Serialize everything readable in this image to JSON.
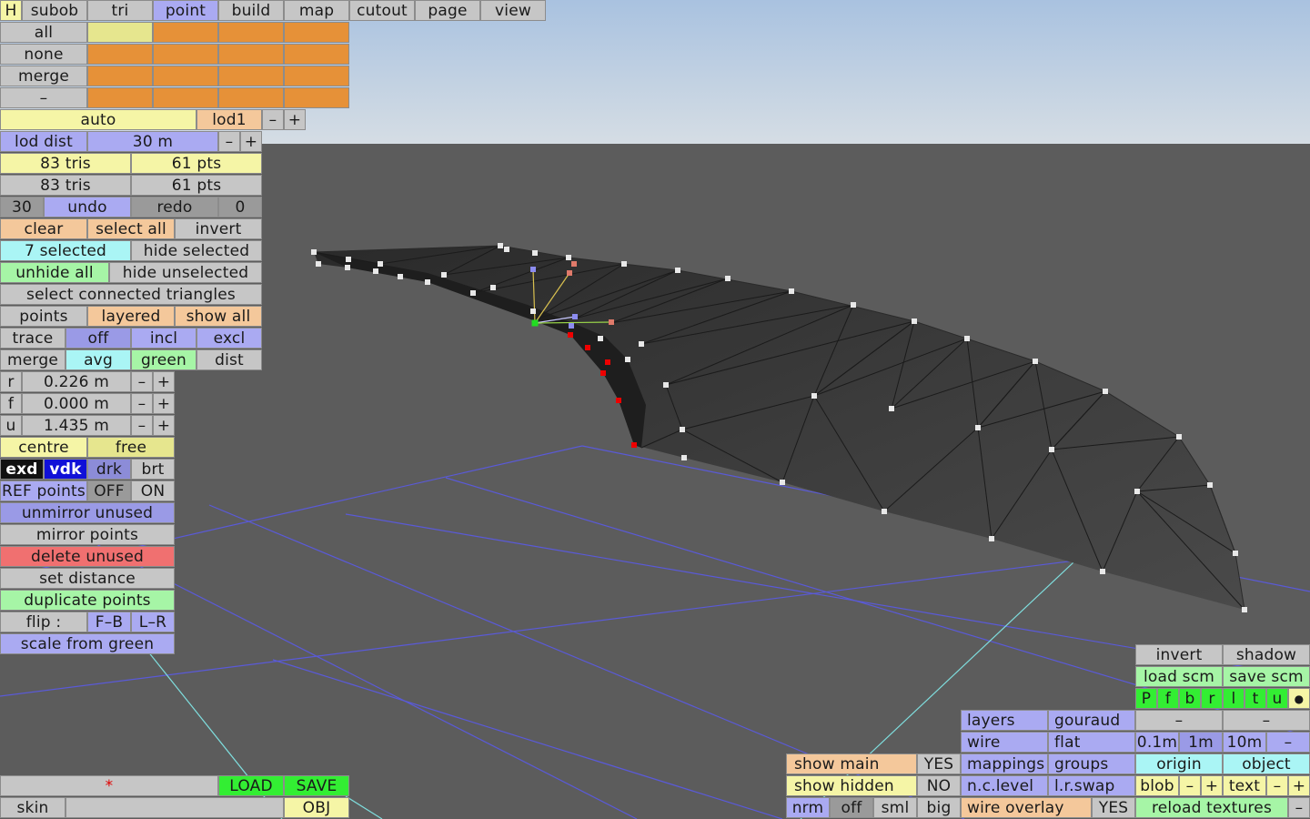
{
  "menu": {
    "h": "H",
    "subob": "subob",
    "tri": "tri",
    "point": "point",
    "build": "build",
    "map": "map",
    "cutout": "cutout",
    "page": "page",
    "view": "view"
  },
  "layers": {
    "all": "all",
    "none": "none",
    "merge": "merge",
    "dash": "–"
  },
  "lod": {
    "auto": "auto",
    "lod1": "lod1",
    "minus": "–",
    "plus": "+",
    "dist_label": "lod dist",
    "dist_value": "30 m"
  },
  "stats": {
    "tris1": "83 tris",
    "pts1": "61 pts",
    "tris2": "83 tris",
    "pts2": "61 pts"
  },
  "undo": {
    "count": "30",
    "undo": "undo",
    "redo": "redo",
    "redo_count": "0"
  },
  "select": {
    "clear": "clear",
    "select_all": "select all",
    "invert": "invert",
    "selected": "7 selected",
    "hide_selected": "hide selected",
    "unhide_all": "unhide all",
    "hide_unselected": "hide unselected",
    "connected": "select connected triangles"
  },
  "points": {
    "points": "points",
    "layered": "layered",
    "show_all": "show all",
    "trace": "trace",
    "off": "off",
    "incl": "incl",
    "excl": "excl",
    "merge": "merge",
    "avg": "avg",
    "green": "green",
    "dist": "dist"
  },
  "coords": {
    "r_label": "r",
    "r_value": "0.226 m",
    "f_label": "f",
    "f_value": "0.000 m",
    "u_label": "u",
    "u_value": "1.435 m",
    "minus": "–",
    "plus": "+"
  },
  "tools": {
    "centre": "centre",
    "free": "free",
    "exd": "exd",
    "vdk": "vdk",
    "drk": "drk",
    "brt": "brt",
    "ref_points": "REF points",
    "ref_off": "OFF",
    "ref_on": "ON",
    "unmirror": "unmirror unused",
    "mirror": "mirror points",
    "delete": "delete unused",
    "set_distance": "set distance",
    "duplicate": "duplicate points",
    "flip": "flip :",
    "fb": "F–B",
    "lr": "L–R",
    "scale_green": "scale from green"
  },
  "file": {
    "star": "*",
    "load": "LOAD",
    "save": "SAVE",
    "skin": "skin",
    "obj": "OBJ"
  },
  "show": {
    "main": "show main",
    "main_value": "YES",
    "hidden": "show hidden",
    "hidden_value": "NO",
    "nrm": "nrm",
    "off": "off",
    "sml": "sml",
    "big": "big"
  },
  "render": {
    "layers": "layers",
    "gouraud": "gouraud",
    "wire": "wire",
    "flat": "flat",
    "mappings": "mappings",
    "groups": "groups",
    "nclevel": "n.c.level",
    "lrswap": "l.r.swap",
    "wire_overlay": "wire overlay",
    "wire_overlay_value": "YES"
  },
  "view": {
    "invert": "invert",
    "shadow": "shadow",
    "load_scm": "load scm",
    "save_scm": "save scm",
    "letters": [
      "P",
      "f",
      "b",
      "r",
      "l",
      "t",
      "u"
    ],
    "dot": "●",
    "dash1": "–",
    "dash2": "–",
    "grid_01": "0.1m",
    "grid_1": "1m",
    "grid_10": "10m",
    "grid_minus": "–",
    "origin": "origin",
    "object": "object",
    "blob": "blob",
    "blob_minus": "–",
    "blob_plus": "+",
    "text": "text",
    "text_minus": "–",
    "text_plus": "+",
    "reload": "reload textures",
    "reload_minus": "–"
  },
  "colors": {
    "sky_top": "#b3cbe5",
    "ground": "#5c5c5c",
    "mesh": "#3a3a3a",
    "grid_blue": "#5a5ad8",
    "grid_cyan": "#7fdede",
    "selected_point": "#ee0000",
    "green_point": "#22dd22"
  }
}
